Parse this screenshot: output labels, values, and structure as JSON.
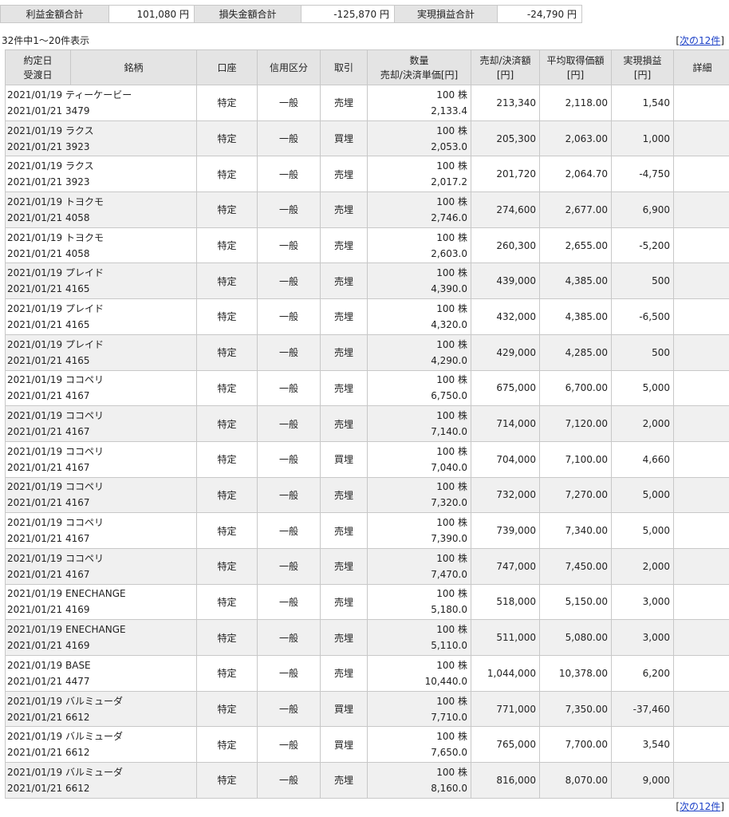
{
  "summary": {
    "profit_label": "利益金額合計",
    "profit_value": "101,080 円",
    "loss_label": "損失金額合計",
    "loss_value": "-125,870 円",
    "realized_label": "実現損益合計",
    "realized_value": "-24,790 円"
  },
  "count_text": "32件中1～20件表示",
  "pager": {
    "open": "[",
    "next_label": "次の12件",
    "close": "]"
  },
  "headers": {
    "date_1": "約定日",
    "date_2": "受渡日",
    "name": "銘柄",
    "account": "口座",
    "credit": "信用区分",
    "trade": "取引",
    "qty_1": "数量",
    "qty_2": "売却/決済単価[円]",
    "amount_1": "売却/決済額",
    "amount_2": "[円]",
    "avg_1": "平均取得価額",
    "avg_2": "[円]",
    "pl_1": "実現損益",
    "pl_2": "[円]",
    "detail": "詳細"
  },
  "rows": [
    {
      "trade_date": "2021/01/19",
      "settle_date": "2021/01/21",
      "name": "ティーケービー",
      "code": "3479",
      "account": "特定",
      "credit": "一般",
      "trade": "売埋",
      "qty": "100 株",
      "price": "2,133.4",
      "amount": "213,340",
      "avg": "2,118.00",
      "pl": "1,540"
    },
    {
      "trade_date": "2021/01/19",
      "settle_date": "2021/01/21",
      "name": "ラクス",
      "code": "3923",
      "account": "特定",
      "credit": "一般",
      "trade": "買埋",
      "qty": "100 株",
      "price": "2,053.0",
      "amount": "205,300",
      "avg": "2,063.00",
      "pl": "1,000"
    },
    {
      "trade_date": "2021/01/19",
      "settle_date": "2021/01/21",
      "name": "ラクス",
      "code": "3923",
      "account": "特定",
      "credit": "一般",
      "trade": "売埋",
      "qty": "100 株",
      "price": "2,017.2",
      "amount": "201,720",
      "avg": "2,064.70",
      "pl": "-4,750"
    },
    {
      "trade_date": "2021/01/19",
      "settle_date": "2021/01/21",
      "name": "トヨクモ",
      "code": "4058",
      "account": "特定",
      "credit": "一般",
      "trade": "売埋",
      "qty": "100 株",
      "price": "2,746.0",
      "amount": "274,600",
      "avg": "2,677.00",
      "pl": "6,900"
    },
    {
      "trade_date": "2021/01/19",
      "settle_date": "2021/01/21",
      "name": "トヨクモ",
      "code": "4058",
      "account": "特定",
      "credit": "一般",
      "trade": "売埋",
      "qty": "100 株",
      "price": "2,603.0",
      "amount": "260,300",
      "avg": "2,655.00",
      "pl": "-5,200"
    },
    {
      "trade_date": "2021/01/19",
      "settle_date": "2021/01/21",
      "name": "プレイド",
      "code": "4165",
      "account": "特定",
      "credit": "一般",
      "trade": "売埋",
      "qty": "100 株",
      "price": "4,390.0",
      "amount": "439,000",
      "avg": "4,385.00",
      "pl": "500"
    },
    {
      "trade_date": "2021/01/19",
      "settle_date": "2021/01/21",
      "name": "プレイド",
      "code": "4165",
      "account": "特定",
      "credit": "一般",
      "trade": "売埋",
      "qty": "100 株",
      "price": "4,320.0",
      "amount": "432,000",
      "avg": "4,385.00",
      "pl": "-6,500"
    },
    {
      "trade_date": "2021/01/19",
      "settle_date": "2021/01/21",
      "name": "プレイド",
      "code": "4165",
      "account": "特定",
      "credit": "一般",
      "trade": "売埋",
      "qty": "100 株",
      "price": "4,290.0",
      "amount": "429,000",
      "avg": "4,285.00",
      "pl": "500"
    },
    {
      "trade_date": "2021/01/19",
      "settle_date": "2021/01/21",
      "name": "ココペリ",
      "code": "4167",
      "account": "特定",
      "credit": "一般",
      "trade": "売埋",
      "qty": "100 株",
      "price": "6,750.0",
      "amount": "675,000",
      "avg": "6,700.00",
      "pl": "5,000"
    },
    {
      "trade_date": "2021/01/19",
      "settle_date": "2021/01/21",
      "name": "ココペリ",
      "code": "4167",
      "account": "特定",
      "credit": "一般",
      "trade": "売埋",
      "qty": "100 株",
      "price": "7,140.0",
      "amount": "714,000",
      "avg": "7,120.00",
      "pl": "2,000"
    },
    {
      "trade_date": "2021/01/19",
      "settle_date": "2021/01/21",
      "name": "ココペリ",
      "code": "4167",
      "account": "特定",
      "credit": "一般",
      "trade": "買埋",
      "qty": "100 株",
      "price": "7,040.0",
      "amount": "704,000",
      "avg": "7,100.00",
      "pl": "4,660"
    },
    {
      "trade_date": "2021/01/19",
      "settle_date": "2021/01/21",
      "name": "ココペリ",
      "code": "4167",
      "account": "特定",
      "credit": "一般",
      "trade": "売埋",
      "qty": "100 株",
      "price": "7,320.0",
      "amount": "732,000",
      "avg": "7,270.00",
      "pl": "5,000"
    },
    {
      "trade_date": "2021/01/19",
      "settle_date": "2021/01/21",
      "name": "ココペリ",
      "code": "4167",
      "account": "特定",
      "credit": "一般",
      "trade": "売埋",
      "qty": "100 株",
      "price": "7,390.0",
      "amount": "739,000",
      "avg": "7,340.00",
      "pl": "5,000"
    },
    {
      "trade_date": "2021/01/19",
      "settle_date": "2021/01/21",
      "name": "ココペリ",
      "code": "4167",
      "account": "特定",
      "credit": "一般",
      "trade": "売埋",
      "qty": "100 株",
      "price": "7,470.0",
      "amount": "747,000",
      "avg": "7,450.00",
      "pl": "2,000"
    },
    {
      "trade_date": "2021/01/19",
      "settle_date": "2021/01/21",
      "name": "ENECHANGE",
      "code": "4169",
      "account": "特定",
      "credit": "一般",
      "trade": "売埋",
      "qty": "100 株",
      "price": "5,180.0",
      "amount": "518,000",
      "avg": "5,150.00",
      "pl": "3,000"
    },
    {
      "trade_date": "2021/01/19",
      "settle_date": "2021/01/21",
      "name": "ENECHANGE",
      "code": "4169",
      "account": "特定",
      "credit": "一般",
      "trade": "売埋",
      "qty": "100 株",
      "price": "5,110.0",
      "amount": "511,000",
      "avg": "5,080.00",
      "pl": "3,000"
    },
    {
      "trade_date": "2021/01/19",
      "settle_date": "2021/01/21",
      "name": "BASE",
      "code": "4477",
      "account": "特定",
      "credit": "一般",
      "trade": "売埋",
      "qty": "100 株",
      "price": "10,440.0",
      "amount": "1,044,000",
      "avg": "10,378.00",
      "pl": "6,200"
    },
    {
      "trade_date": "2021/01/19",
      "settle_date": "2021/01/21",
      "name": "バルミューダ",
      "code": "6612",
      "account": "特定",
      "credit": "一般",
      "trade": "買埋",
      "qty": "100 株",
      "price": "7,710.0",
      "amount": "771,000",
      "avg": "7,350.00",
      "pl": "-37,460"
    },
    {
      "trade_date": "2021/01/19",
      "settle_date": "2021/01/21",
      "name": "バルミューダ",
      "code": "6612",
      "account": "特定",
      "credit": "一般",
      "trade": "買埋",
      "qty": "100 株",
      "price": "7,650.0",
      "amount": "765,000",
      "avg": "7,700.00",
      "pl": "3,540"
    },
    {
      "trade_date": "2021/01/19",
      "settle_date": "2021/01/21",
      "name": "バルミューダ",
      "code": "6612",
      "account": "特定",
      "credit": "一般",
      "trade": "売埋",
      "qty": "100 株",
      "price": "8,160.0",
      "amount": "816,000",
      "avg": "8,070.00",
      "pl": "9,000"
    }
  ]
}
